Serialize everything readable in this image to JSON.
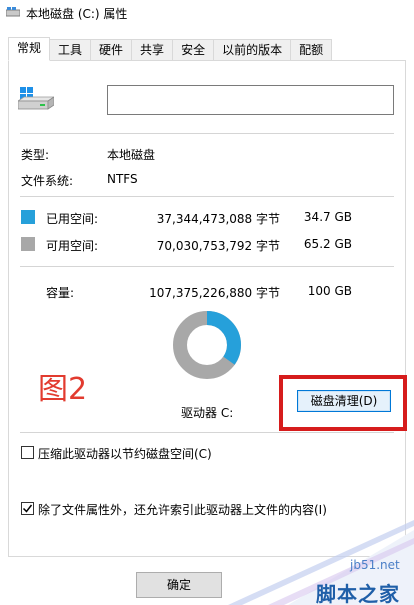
{
  "window": {
    "title": "本地磁盘 (C:) 属性"
  },
  "tabs": [
    {
      "label": "常规",
      "active": true
    },
    {
      "label": "工具"
    },
    {
      "label": "硬件"
    },
    {
      "label": "共享"
    },
    {
      "label": "安全"
    },
    {
      "label": "以前的版本"
    },
    {
      "label": "配额"
    }
  ],
  "general": {
    "name_value": "",
    "type_label": "类型:",
    "type_value": "本地磁盘",
    "fs_label": "文件系统:",
    "fs_value": "NTFS",
    "used": {
      "label": "已用空间:",
      "bytes": "37,344,473,088 字节",
      "size": "34.7 GB",
      "color": "#26a0da",
      "fraction": 0.348
    },
    "free": {
      "label": "可用空间:",
      "bytes": "70,030,753,792 字节",
      "size": "65.2 GB",
      "color": "#a8a8a8"
    },
    "capacity": {
      "label": "容量:",
      "bytes": "107,375,226,880 字节",
      "size": "100 GB"
    },
    "drive_label": "驱动器 C:",
    "cleanup_button": "磁盘清理(D)",
    "figure_label": "图2",
    "compress_checkbox": {
      "label": "压缩此驱动器以节约磁盘空间(C)",
      "checked": false
    },
    "index_checkbox": {
      "label": "除了文件属性外，还允许索引此驱动器上文件的内容(I)",
      "checked": true
    }
  },
  "footer": {
    "ok_button": "确定"
  },
  "watermark": {
    "url": "jb51.net",
    "text": "脚本之家"
  },
  "icons": [
    "drive-icon",
    "drive-large-icon",
    "checkmark-icon"
  ]
}
